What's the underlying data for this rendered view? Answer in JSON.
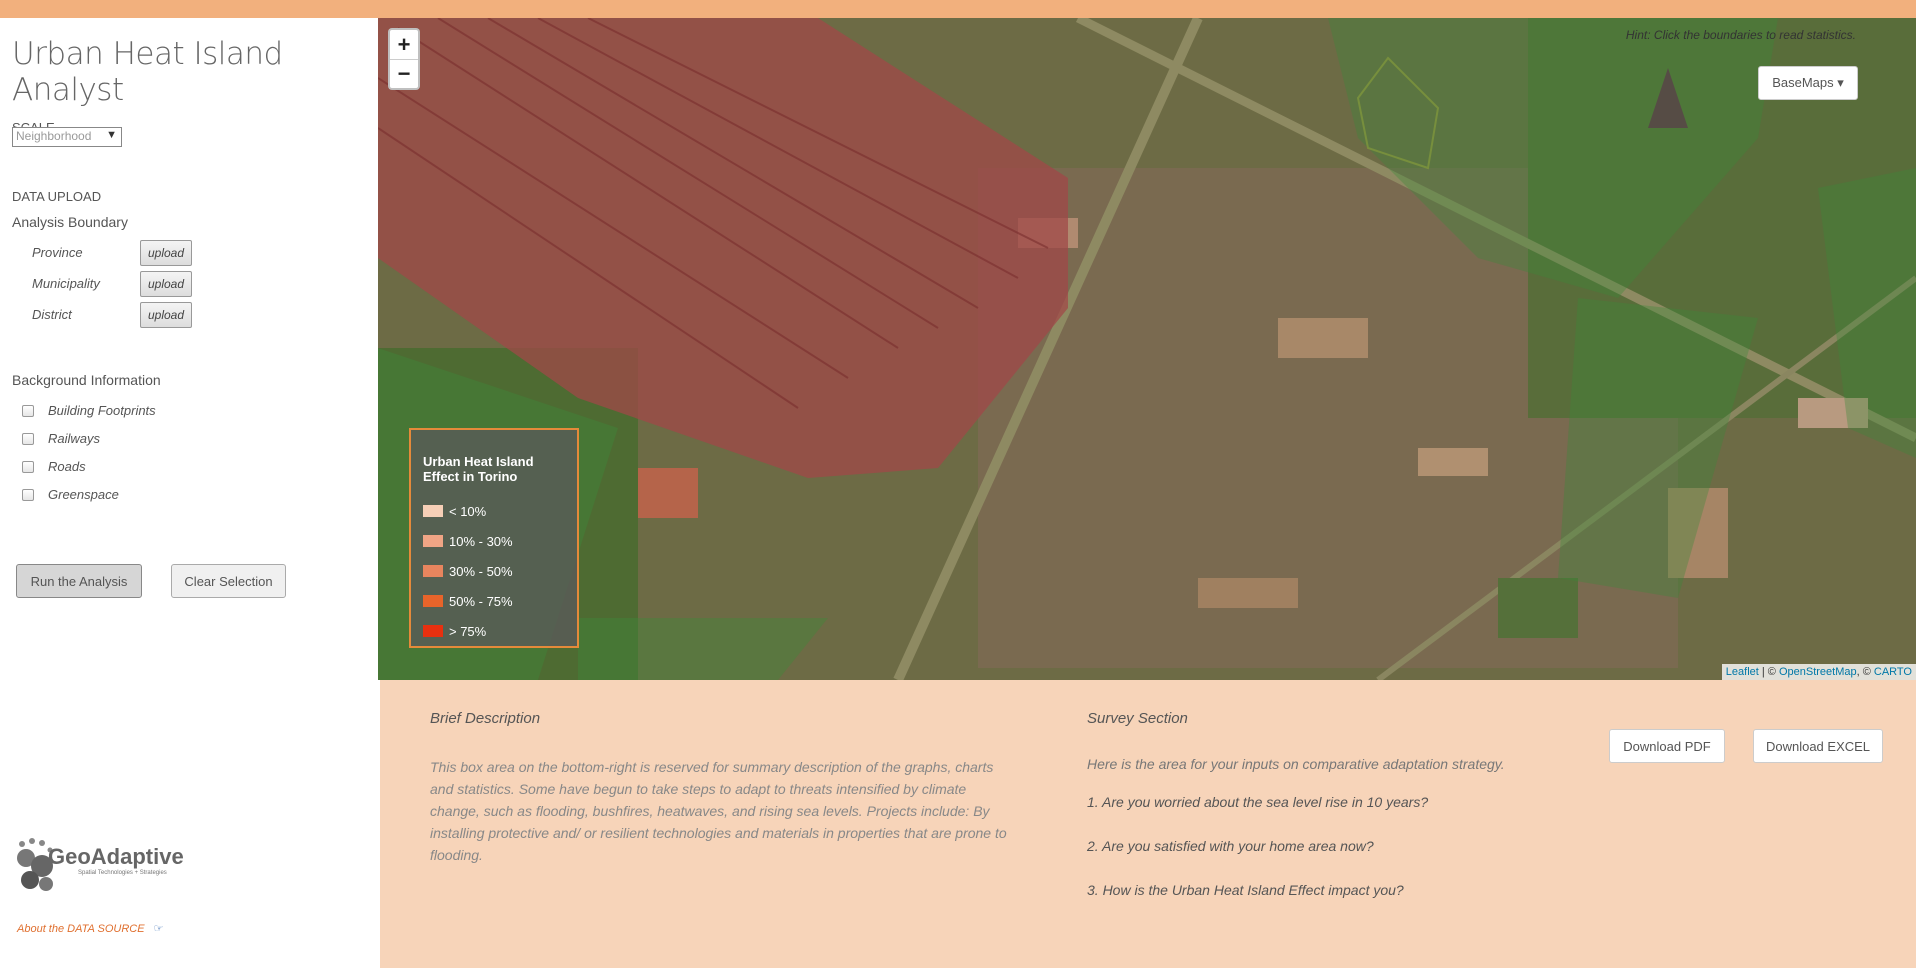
{
  "app": {
    "title": "Urban Heat Island Analyst"
  },
  "sidebar": {
    "scale_label": "SCALE",
    "scale_value": "Neighborhood",
    "data_upload_label": "DATA UPLOAD",
    "analysis_boundary_label": "Analysis Boundary",
    "uploads": [
      {
        "label": "Province",
        "button": "upload"
      },
      {
        "label": "Municipality",
        "button": "upload"
      },
      {
        "label": "District",
        "button": "upload"
      }
    ],
    "background_label": "Background Information",
    "layers": [
      {
        "label": "Building Footprints",
        "checked": false
      },
      {
        "label": "Railways",
        "checked": false
      },
      {
        "label": "Roads",
        "checked": false
      },
      {
        "label": "Greenspace",
        "checked": false
      }
    ],
    "run_button": "Run the Analysis",
    "clear_button": "Clear Selection",
    "logo_name": "GeoAdaptive",
    "logo_tagline": "Spatial Technologies + Strategies",
    "about_link": "About the DATA SOURCE"
  },
  "map": {
    "zoom_in": "+",
    "zoom_out": "−",
    "hint": "Hint: Click the boundaries to read statistics.",
    "basemaps_button": "BaseMaps ▾",
    "legend": {
      "title": "Urban Heat Island Effect in Torino",
      "items": [
        {
          "label": "< 10%",
          "color": "#f6cfb6"
        },
        {
          "label": "10% - 30%",
          "color": "#f0a585"
        },
        {
          "label": "30% - 50%",
          "color": "#e8855e"
        },
        {
          "label": "50% - 75%",
          "color": "#e8642a"
        },
        {
          "label": "> 75%",
          "color": "#e8300f"
        }
      ]
    },
    "attribution": {
      "leaflet": "Leaflet",
      "sep1": " | © ",
      "osm": "OpenStreetMap",
      "sep2": ", © ",
      "carto": "CARTO"
    }
  },
  "bottom": {
    "brief_title": "Brief Description",
    "brief_text": "This box area on the bottom-right is reserved for summary description of the graphs, charts and statistics. Some have begun to take steps to adapt to threats intensified by climate change, such as flooding, bushfires, heatwaves, and rising sea levels. Projects include: By installing protective and/ or resilient technologies and materials in properties that are prone to flooding.",
    "survey_title": "Survey Section",
    "survey_intro": "Here is the area for your inputs on comparative adaptation strategy.",
    "questions": [
      "1. Are you worried about the sea level rise in 10 years?",
      "2. Are you satisfied with your home area now?",
      "3. How is the Urban Heat Island Effect impact you?"
    ],
    "download_pdf": "Download PDF",
    "download_excel": "Download EXCEL"
  },
  "colors": {
    "accent": "#f2b07d",
    "panel_bg": "#f7d4b9",
    "legend_border": "#e58a3a"
  }
}
